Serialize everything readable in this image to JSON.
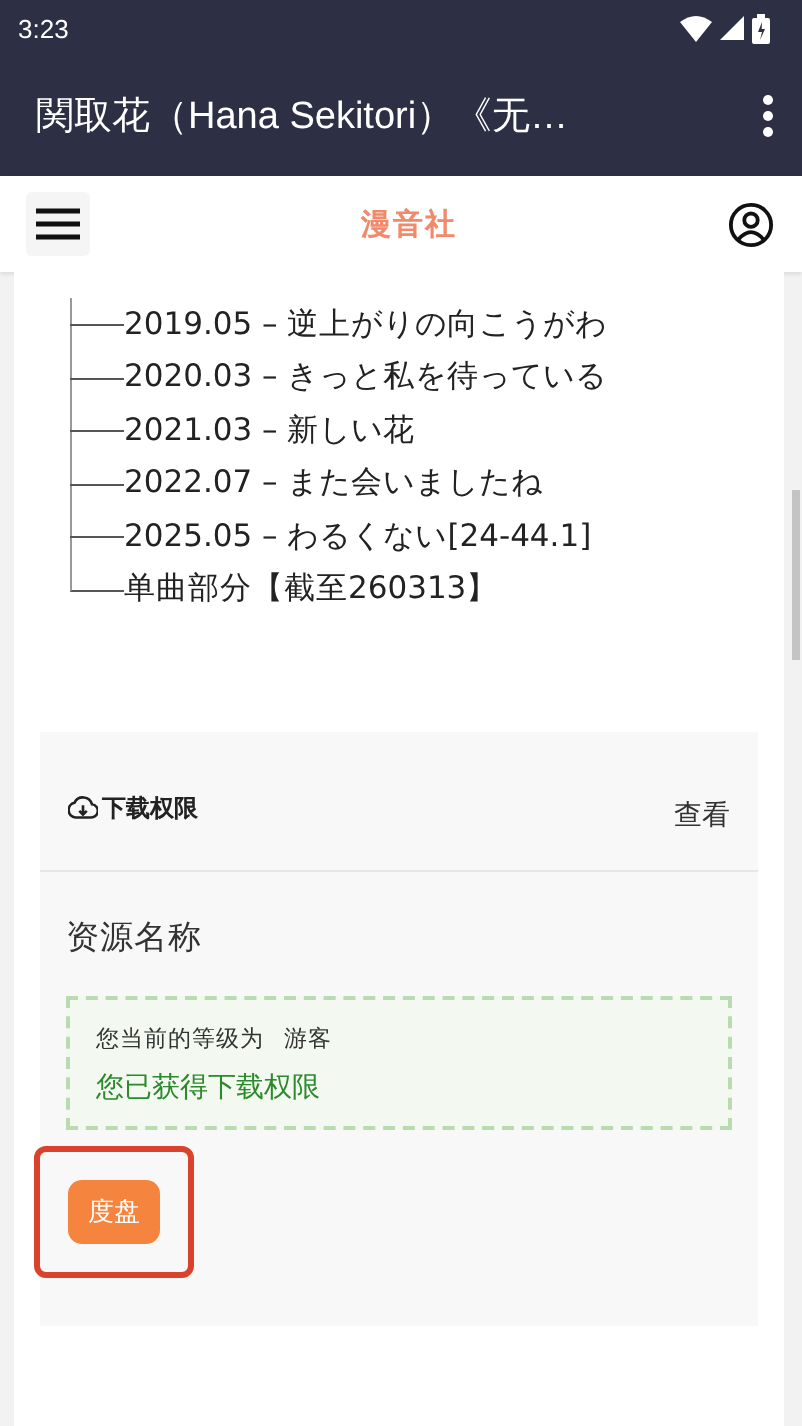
{
  "status_bar": {
    "time": "3:23"
  },
  "app_bar": {
    "title": "関取花（Hana Sekitori）《无…"
  },
  "site_header": {
    "logo": "漫音社"
  },
  "tree": [
    {
      "text": "2019.05 – 逆上がりの向こうがわ"
    },
    {
      "text": "2020.03 – きっと私を待っている"
    },
    {
      "text": "2021.03 – 新しい花"
    },
    {
      "text": "2022.07 – また会いましたね"
    },
    {
      "text": "2025.05 – わるくない[24-44.1]"
    },
    {
      "text": "单曲部分【截至260313】"
    }
  ],
  "download_panel": {
    "title": "下载权限",
    "view_link": "查看",
    "resource_name": "资源名称",
    "level_label": "您当前的等级为",
    "level_value": "游客",
    "permission_message": "您已获得下载权限",
    "buttons": [
      {
        "label": "度盘",
        "highlighted": true
      }
    ]
  }
}
